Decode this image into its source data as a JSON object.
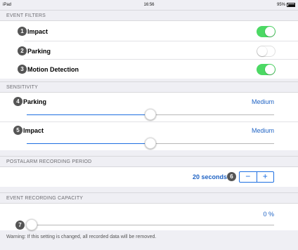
{
  "status_bar": {
    "device": "iPad",
    "time": "16:56",
    "battery": "95%"
  },
  "event_filters": {
    "header": "EVENT FILTERS",
    "items": [
      {
        "badge": "1",
        "label": "Impact",
        "on": true
      },
      {
        "badge": "2",
        "label": "Parking",
        "on": false
      },
      {
        "badge": "3",
        "label": "Motion Detection",
        "on": true
      }
    ]
  },
  "sensitivity": {
    "header": "SENSITIVITY",
    "items": [
      {
        "badge": "4",
        "label": "Parking",
        "value": "Medium",
        "level": 0.5
      },
      {
        "badge": "5",
        "label": "Impact",
        "value": "Medium",
        "level": 0.5
      }
    ]
  },
  "recording_period": {
    "header": "POSTALARM RECORDING PERIOD",
    "value": "20 seconds",
    "badge": "6",
    "minus": "−",
    "plus": "+"
  },
  "capacity": {
    "header": "EVENT RECORDING CAPACITY",
    "value": "0 %",
    "badge": "7",
    "level": 0
  },
  "warning": "Warning: If this setting is changed, all recorded data will be removed.",
  "colors": {
    "accent": "#1e6fe1",
    "toggle_on": "#4cd964",
    "background": "#efeff4"
  }
}
